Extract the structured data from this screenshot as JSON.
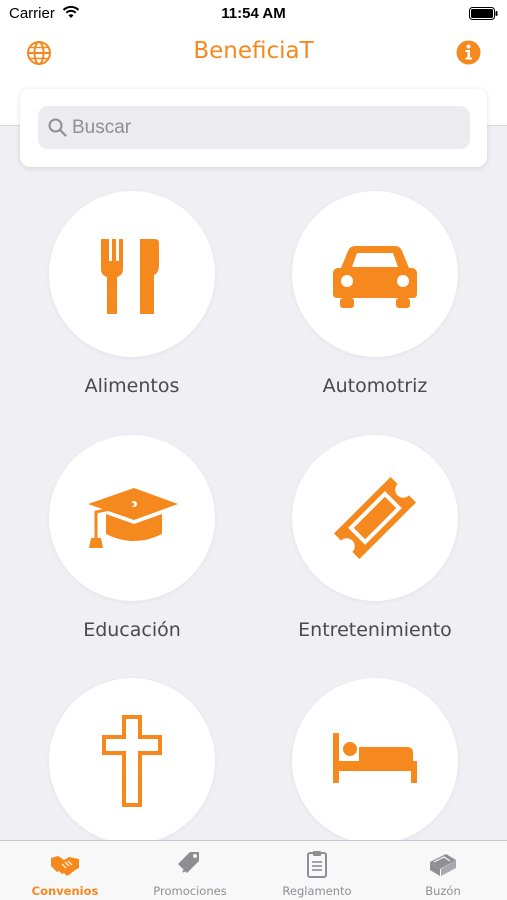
{
  "status_bar": {
    "carrier": "Carrier",
    "time": "11:54 AM"
  },
  "nav": {
    "title": "BeneficiaT",
    "left_icon": "globe-icon",
    "right_icon": "info-icon"
  },
  "search": {
    "placeholder": "Buscar",
    "value": ""
  },
  "categories": [
    {
      "label": "Alimentos",
      "icon": "fork-knife-icon"
    },
    {
      "label": "Automotriz",
      "icon": "car-icon"
    },
    {
      "label": "Educación",
      "icon": "graduation-cap-icon"
    },
    {
      "label": "Entretenimiento",
      "icon": "ticket-icon"
    },
    {
      "label": "",
      "icon": "cross-icon"
    },
    {
      "label": "",
      "icon": "bed-icon"
    }
  ],
  "tabs": [
    {
      "label": "Convenios",
      "icon": "handshake-icon",
      "active": true
    },
    {
      "label": "Promociones",
      "icon": "tags-icon",
      "active": false
    },
    {
      "label": "Reglamento",
      "icon": "clipboard-icon",
      "active": false
    },
    {
      "label": "Buzón",
      "icon": "mailbox-icon",
      "active": false
    }
  ],
  "colors": {
    "accent": "#f5891e",
    "background": "#efeff4",
    "tab_inactive": "#8e8e93"
  }
}
